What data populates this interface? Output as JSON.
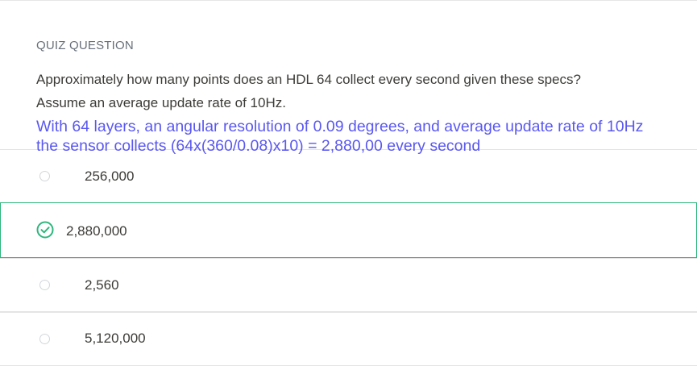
{
  "quiz": {
    "section_label": "QUIZ QUESTION",
    "question_line1": "Approximately how many points does an HDL 64 collect every second given these specs?",
    "question_line2": "Assume an average update rate of 10Hz.",
    "annotation": "With 64 layers, an angular resolution of 0.09 degrees, and average update rate of 10Hz the sensor collects (64x(360/0.08)x10) = 2,880,00 every second",
    "options": [
      {
        "label": "256,000",
        "selected": false
      },
      {
        "label": "2,880,000",
        "selected": true
      },
      {
        "label": "2,560",
        "selected": false
      },
      {
        "label": "5,120,000",
        "selected": false
      }
    ]
  },
  "colors": {
    "correct": "#2eb67d",
    "annotation": "#5a58f0"
  }
}
